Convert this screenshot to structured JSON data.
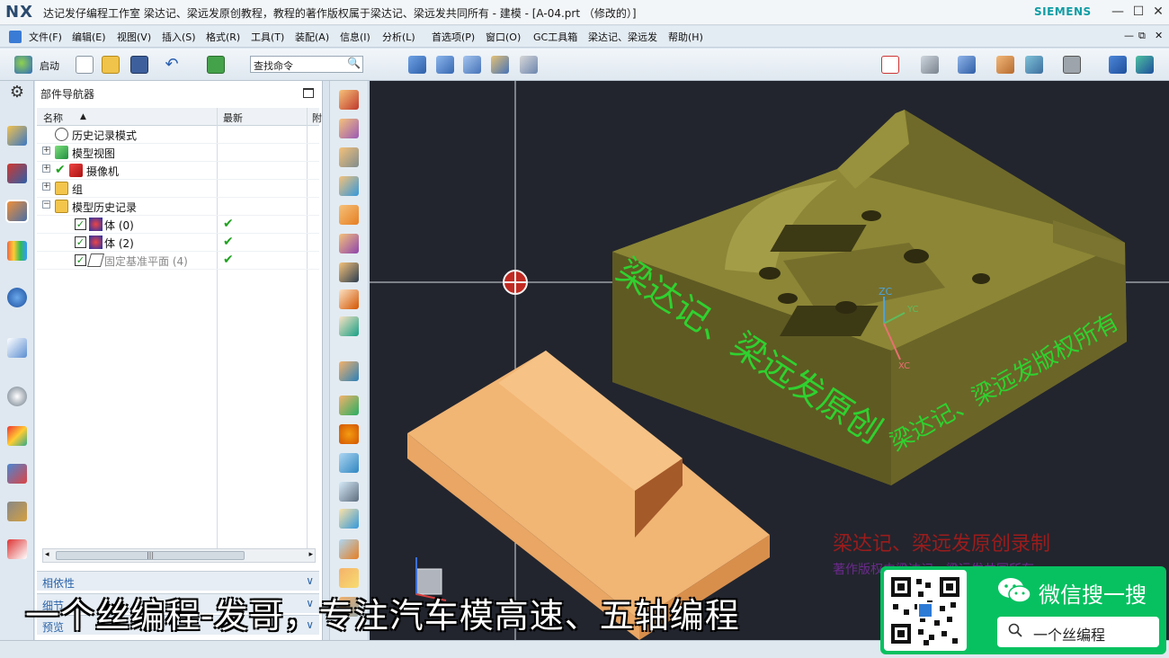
{
  "window": {
    "logo": "NX",
    "title": "达记发仔编程工作室 梁达记、梁远发原创教程，教程的著作版权属于梁达记、梁远发共同所有 - 建模 - [A-04.prt （修改的）]",
    "brand": "SIEMENS",
    "minimize_glyph": "—",
    "restore_glyph": "☐",
    "close_glyph": "✕"
  },
  "menu": {
    "items": [
      "文件(F)",
      "编辑(E)",
      "视图(V)",
      "插入(S)",
      "格式(R)",
      "工具(T)",
      "装配(A)",
      "信息(I)",
      "分析(L)",
      "首选项(P)",
      "窗口(O)",
      "GC工具箱",
      "梁达记、梁远发",
      "帮助(H)"
    ],
    "sub_min": "—",
    "sub_restore": "⧉",
    "sub_close": "✕"
  },
  "toolbar": {
    "start_label": "启动",
    "search_placeholder": "查找命令",
    "search_icon": "🔍"
  },
  "navigator": {
    "title": "部件导航器",
    "columns": {
      "name": "名称",
      "sort_arrow": "▲",
      "latest": "最新",
      "attached": "附"
    },
    "rows": [
      {
        "label": "历史记录模式",
        "icon": "clock-icon"
      },
      {
        "label": "模型视图",
        "icon": "model-view-icon"
      },
      {
        "label": "摄像机",
        "icon": "camera-icon"
      },
      {
        "label": "组",
        "icon": "folder-icon"
      },
      {
        "label": "模型历史记录",
        "icon": "folder-icon"
      },
      {
        "label": "体 (0)",
        "icon": "body-icon",
        "latest": "✔"
      },
      {
        "label": "体 (2)",
        "icon": "body-icon",
        "latest": "✔"
      },
      {
        "label": "固定基准平面 (4)",
        "icon": "datum-plane-icon",
        "latest": "✔"
      }
    ],
    "scroll_grip": "|||",
    "panels": [
      {
        "label": "相依性",
        "chevron": "∨"
      },
      {
        "label": "细节",
        "chevron": "∨"
      },
      {
        "label": "预览",
        "chevron": "∨"
      }
    ]
  },
  "viewport": {
    "watermark_front": "梁达记、梁远发原创",
    "watermark_side": "梁达记、梁远发版权所有",
    "watermark_red": "梁达记、梁远发原创录制",
    "watermark_purple": "著作版权由梁达记、梁远发共同所有",
    "axis_labels": {
      "zc": "ZC",
      "yc": "YC",
      "xc": "XC"
    }
  },
  "overlay": {
    "subtitle": "一个丝编程-发哥，专注汽车模高速、五轴编程",
    "wechat_title": "微信搜一搜",
    "wechat_search": "一个丝编程"
  },
  "colors": {
    "mold_body": "#6f6a2a",
    "block": "#e9a664",
    "watermark_green": "#2fd12f",
    "wechat_green": "#07c160",
    "viewport_bg": "#22252e"
  }
}
